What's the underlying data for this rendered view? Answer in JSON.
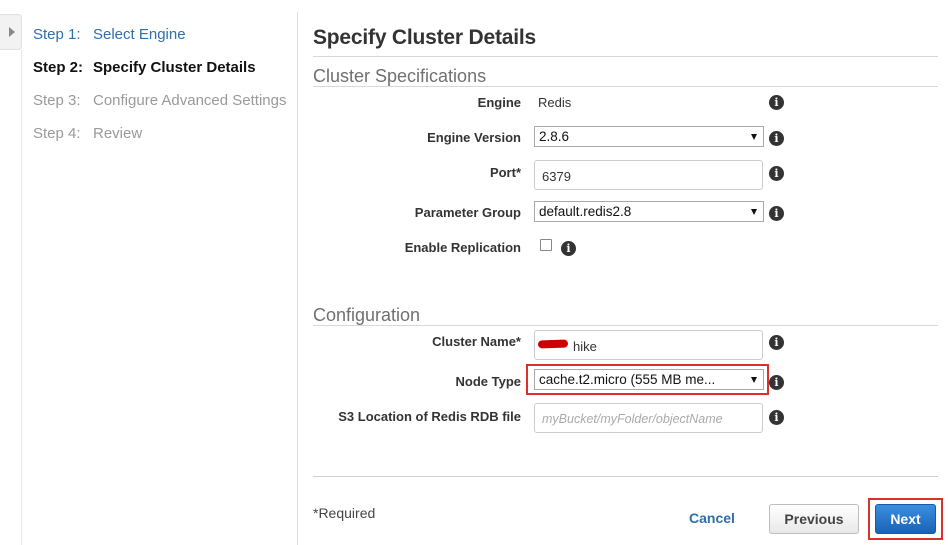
{
  "wizard": {
    "steps": [
      {
        "num": "Step 1:",
        "label": "Select Engine"
      },
      {
        "num": "Step 2:",
        "label": "Specify Cluster Details"
      },
      {
        "num": "Step 3:",
        "label": "Configure Advanced Settings"
      },
      {
        "num": "Step 4:",
        "label": "Review"
      }
    ]
  },
  "page": {
    "title": "Specify Cluster Details"
  },
  "cluster_specs": {
    "section_title": "Cluster Specifications",
    "engine_label": "Engine",
    "engine_value": "Redis",
    "engine_version_label": "Engine Version",
    "engine_version_value": "2.8.6",
    "port_label": "Port*",
    "port_value": "6379",
    "parameter_group_label": "Parameter Group",
    "parameter_group_value": "default.redis2.8",
    "replication_label": "Enable Replication",
    "replication_checked": false
  },
  "configuration": {
    "section_title": "Configuration",
    "cluster_name_label": "Cluster Name*",
    "cluster_name_value": "hike",
    "node_type_label": "Node Type",
    "node_type_value": "cache.t2.micro (555 MB me...",
    "s3_label": "S3 Location of Redis RDB file",
    "s3_placeholder": "myBucket/myFolder/objectName"
  },
  "footer": {
    "required_note": "*Required",
    "cancel_label": "Cancel",
    "previous_label": "Previous",
    "next_label": "Next"
  },
  "icons": {
    "info": "info-icon",
    "collapse": "chevron-right-icon"
  },
  "colors": {
    "link": "#2d6fb0",
    "primary_button": "#1a62b6",
    "highlight_box": "#d9312b",
    "redaction": "#cc0000"
  }
}
